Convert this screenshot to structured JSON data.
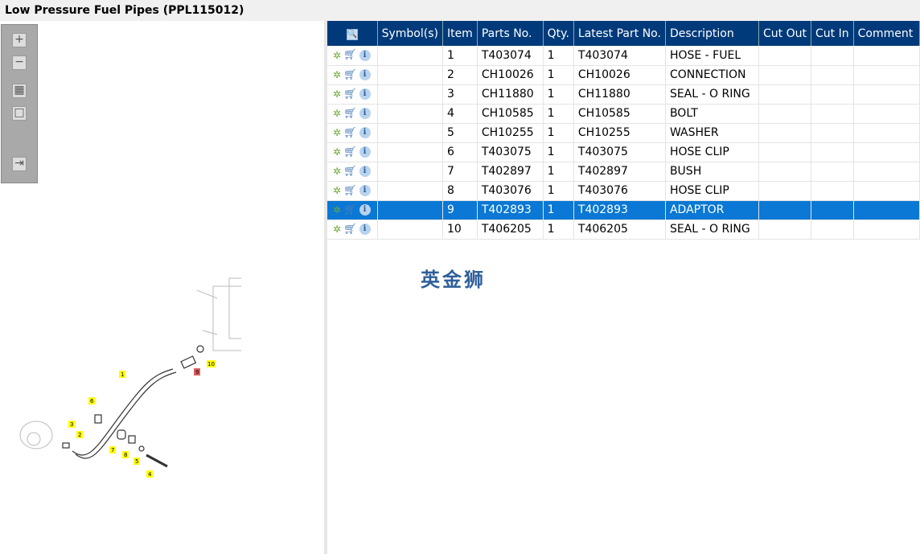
{
  "title": "Low Pressure Fuel Pipes (PPL115012)",
  "toolbar": {
    "zoom_in": "+",
    "zoom_out": "−",
    "fit": "▦",
    "actual": "□",
    "export": "⇥"
  },
  "columns": [
    "Symbol(s)",
    "Item",
    "Parts No.",
    "Qty.",
    "Latest Part No.",
    "Description",
    "Cut Out",
    "Cut In",
    "Comment"
  ],
  "rows": [
    {
      "item": "1",
      "part": "T403074",
      "qty": "1",
      "latest": "T403074",
      "desc": "HOSE - FUEL"
    },
    {
      "item": "2",
      "part": "CH10026",
      "qty": "1",
      "latest": "CH10026",
      "desc": "CONNECTION"
    },
    {
      "item": "3",
      "part": "CH11880",
      "qty": "1",
      "latest": "CH11880",
      "desc": "SEAL - O RING"
    },
    {
      "item": "4",
      "part": "CH10585",
      "qty": "1",
      "latest": "CH10585",
      "desc": "BOLT"
    },
    {
      "item": "5",
      "part": "CH10255",
      "qty": "1",
      "latest": "CH10255",
      "desc": "WASHER"
    },
    {
      "item": "6",
      "part": "T403075",
      "qty": "1",
      "latest": "T403075",
      "desc": "HOSE CLIP"
    },
    {
      "item": "7",
      "part": "T402897",
      "qty": "1",
      "latest": "T402897",
      "desc": "BUSH"
    },
    {
      "item": "8",
      "part": "T403076",
      "qty": "1",
      "latest": "T403076",
      "desc": "HOSE CLIP"
    },
    {
      "item": "9",
      "part": "T402893",
      "qty": "1",
      "latest": "T402893",
      "desc": "ADAPTOR",
      "selected": true
    },
    {
      "item": "10",
      "part": "T406205",
      "qty": "1",
      "latest": "T406205",
      "desc": "SEAL - O RING"
    }
  ],
  "watermark": "英金狮",
  "callouts": [
    "1",
    "2",
    "3",
    "4",
    "5",
    "6",
    "7",
    "8",
    "9",
    "10"
  ]
}
